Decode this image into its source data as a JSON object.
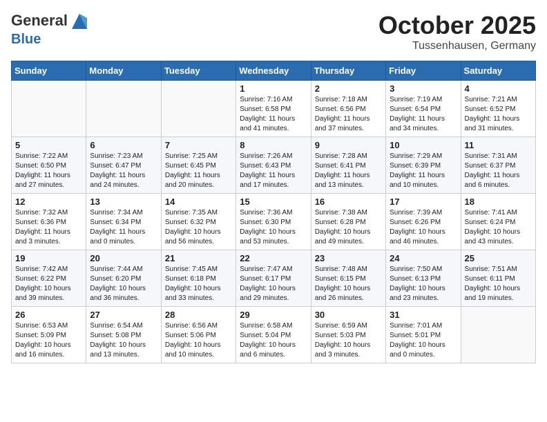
{
  "header": {
    "logo_general": "General",
    "logo_blue": "Blue",
    "month": "October 2025",
    "location": "Tussenhausen, Germany"
  },
  "weekdays": [
    "Sunday",
    "Monday",
    "Tuesday",
    "Wednesday",
    "Thursday",
    "Friday",
    "Saturday"
  ],
  "weeks": [
    [
      {
        "day": "",
        "info": ""
      },
      {
        "day": "",
        "info": ""
      },
      {
        "day": "",
        "info": ""
      },
      {
        "day": "1",
        "info": "Sunrise: 7:16 AM\nSunset: 6:58 PM\nDaylight: 11 hours and 41 minutes."
      },
      {
        "day": "2",
        "info": "Sunrise: 7:18 AM\nSunset: 6:56 PM\nDaylight: 11 hours and 37 minutes."
      },
      {
        "day": "3",
        "info": "Sunrise: 7:19 AM\nSunset: 6:54 PM\nDaylight: 11 hours and 34 minutes."
      },
      {
        "day": "4",
        "info": "Sunrise: 7:21 AM\nSunset: 6:52 PM\nDaylight: 11 hours and 31 minutes."
      }
    ],
    [
      {
        "day": "5",
        "info": "Sunrise: 7:22 AM\nSunset: 6:50 PM\nDaylight: 11 hours and 27 minutes."
      },
      {
        "day": "6",
        "info": "Sunrise: 7:23 AM\nSunset: 6:47 PM\nDaylight: 11 hours and 24 minutes."
      },
      {
        "day": "7",
        "info": "Sunrise: 7:25 AM\nSunset: 6:45 PM\nDaylight: 11 hours and 20 minutes."
      },
      {
        "day": "8",
        "info": "Sunrise: 7:26 AM\nSunset: 6:43 PM\nDaylight: 11 hours and 17 minutes."
      },
      {
        "day": "9",
        "info": "Sunrise: 7:28 AM\nSunset: 6:41 PM\nDaylight: 11 hours and 13 minutes."
      },
      {
        "day": "10",
        "info": "Sunrise: 7:29 AM\nSunset: 6:39 PM\nDaylight: 11 hours and 10 minutes."
      },
      {
        "day": "11",
        "info": "Sunrise: 7:31 AM\nSunset: 6:37 PM\nDaylight: 11 hours and 6 minutes."
      }
    ],
    [
      {
        "day": "12",
        "info": "Sunrise: 7:32 AM\nSunset: 6:36 PM\nDaylight: 11 hours and 3 minutes."
      },
      {
        "day": "13",
        "info": "Sunrise: 7:34 AM\nSunset: 6:34 PM\nDaylight: 11 hours and 0 minutes."
      },
      {
        "day": "14",
        "info": "Sunrise: 7:35 AM\nSunset: 6:32 PM\nDaylight: 10 hours and 56 minutes."
      },
      {
        "day": "15",
        "info": "Sunrise: 7:36 AM\nSunset: 6:30 PM\nDaylight: 10 hours and 53 minutes."
      },
      {
        "day": "16",
        "info": "Sunrise: 7:38 AM\nSunset: 6:28 PM\nDaylight: 10 hours and 49 minutes."
      },
      {
        "day": "17",
        "info": "Sunrise: 7:39 AM\nSunset: 6:26 PM\nDaylight: 10 hours and 46 minutes."
      },
      {
        "day": "18",
        "info": "Sunrise: 7:41 AM\nSunset: 6:24 PM\nDaylight: 10 hours and 43 minutes."
      }
    ],
    [
      {
        "day": "19",
        "info": "Sunrise: 7:42 AM\nSunset: 6:22 PM\nDaylight: 10 hours and 39 minutes."
      },
      {
        "day": "20",
        "info": "Sunrise: 7:44 AM\nSunset: 6:20 PM\nDaylight: 10 hours and 36 minutes."
      },
      {
        "day": "21",
        "info": "Sunrise: 7:45 AM\nSunset: 6:18 PM\nDaylight: 10 hours and 33 minutes."
      },
      {
        "day": "22",
        "info": "Sunrise: 7:47 AM\nSunset: 6:17 PM\nDaylight: 10 hours and 29 minutes."
      },
      {
        "day": "23",
        "info": "Sunrise: 7:48 AM\nSunset: 6:15 PM\nDaylight: 10 hours and 26 minutes."
      },
      {
        "day": "24",
        "info": "Sunrise: 7:50 AM\nSunset: 6:13 PM\nDaylight: 10 hours and 23 minutes."
      },
      {
        "day": "25",
        "info": "Sunrise: 7:51 AM\nSunset: 6:11 PM\nDaylight: 10 hours and 19 minutes."
      }
    ],
    [
      {
        "day": "26",
        "info": "Sunrise: 6:53 AM\nSunset: 5:09 PM\nDaylight: 10 hours and 16 minutes."
      },
      {
        "day": "27",
        "info": "Sunrise: 6:54 AM\nSunset: 5:08 PM\nDaylight: 10 hours and 13 minutes."
      },
      {
        "day": "28",
        "info": "Sunrise: 6:56 AM\nSunset: 5:06 PM\nDaylight: 10 hours and 10 minutes."
      },
      {
        "day": "29",
        "info": "Sunrise: 6:58 AM\nSunset: 5:04 PM\nDaylight: 10 hours and 6 minutes."
      },
      {
        "day": "30",
        "info": "Sunrise: 6:59 AM\nSunset: 5:03 PM\nDaylight: 10 hours and 3 minutes."
      },
      {
        "day": "31",
        "info": "Sunrise: 7:01 AM\nSunset: 5:01 PM\nDaylight: 10 hours and 0 minutes."
      },
      {
        "day": "",
        "info": ""
      }
    ]
  ]
}
